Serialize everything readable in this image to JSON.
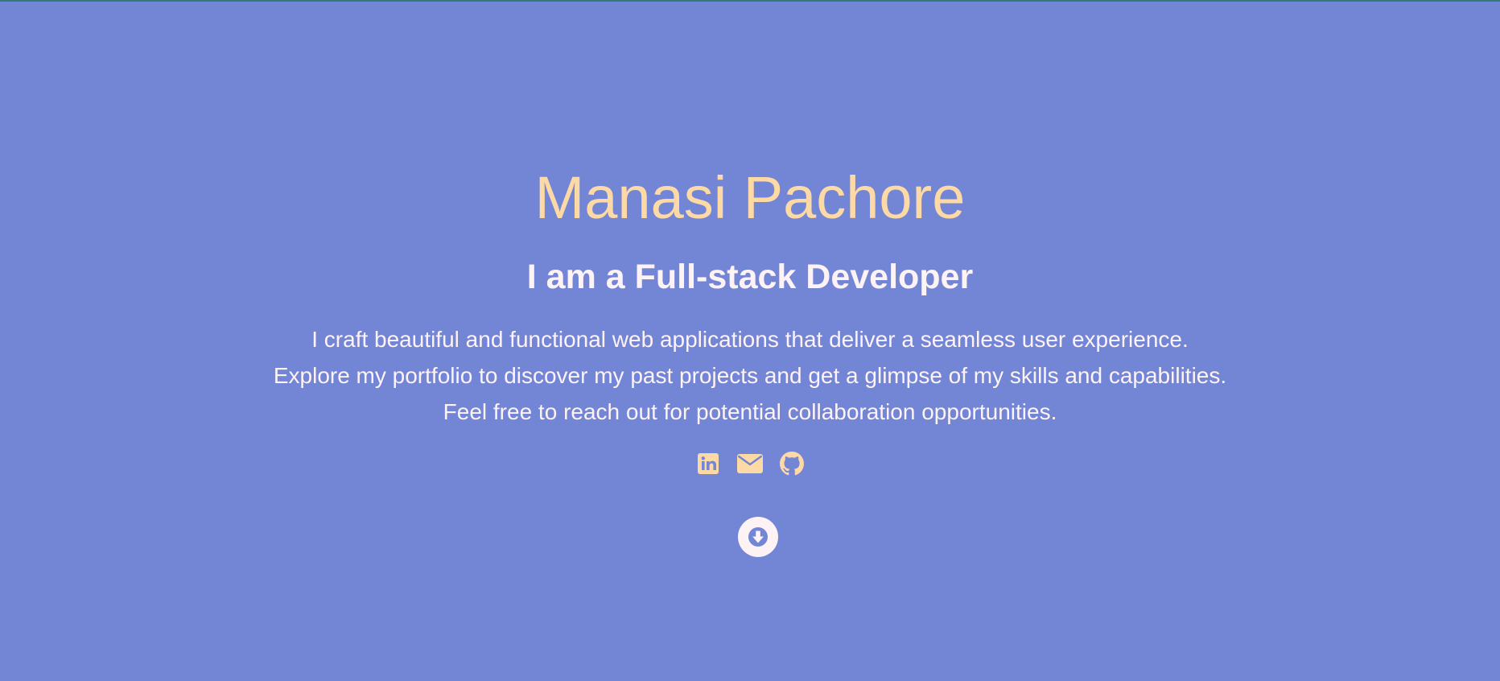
{
  "hero": {
    "name": "Manasi Pachore",
    "role": "I am a Full-stack Developer",
    "description": [
      "I craft beautiful and functional web applications that deliver a seamless user experience.",
      "Explore my portfolio to discover my past projects and get a glimpse of my skills and capabilities.",
      "Feel free to reach out for potential collaboration opportunities."
    ]
  },
  "social": {
    "icons": [
      "linkedin-icon",
      "email-icon",
      "github-icon"
    ]
  },
  "scroll_button": {
    "icon": "arrow-down-circle-icon"
  },
  "colors": {
    "background": "#7386d5",
    "name": "#fdd9a6",
    "text": "#fdf2f4",
    "icon_accent": "#fdd9a6"
  }
}
